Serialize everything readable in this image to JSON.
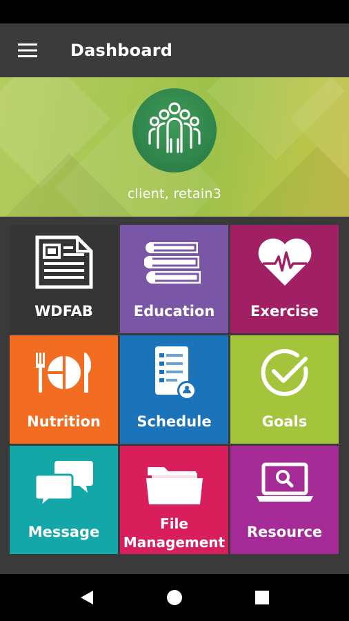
{
  "app_bar": {
    "title": "Dashboard",
    "menu_icon": "hamburger-menu-icon"
  },
  "profile": {
    "name": "client, retain3",
    "avatar_icon": "group-people-icon"
  },
  "tiles": [
    {
      "label": "WDFAB",
      "icon": "newspaper-icon",
      "color": "#353535"
    },
    {
      "label": "Education",
      "icon": "books-icon",
      "color": "#7a56a6"
    },
    {
      "label": "Exercise",
      "icon": "heart-pulse-icon",
      "color": "#a11f63"
    },
    {
      "label": "Nutrition",
      "icon": "plate-fork-knife-icon",
      "color": "#f26d21"
    },
    {
      "label": "Schedule",
      "icon": "checklist-calendar-icon",
      "color": "#1b73ba"
    },
    {
      "label": "Goals",
      "icon": "check-circle-icon",
      "color": "#a4c43b"
    },
    {
      "label": "Message",
      "icon": "chat-bubbles-icon",
      "color": "#14a7a7"
    },
    {
      "label": "File",
      "label2": "Management",
      "icon": "folder-icon",
      "color": "#d81f5c"
    },
    {
      "label": "Resource",
      "icon": "laptop-search-icon",
      "color": "#a52c97"
    }
  ],
  "nav": {
    "back_icon": "back-triangle-icon",
    "home_icon": "home-circle-icon",
    "recents_icon": "recents-square-icon"
  }
}
